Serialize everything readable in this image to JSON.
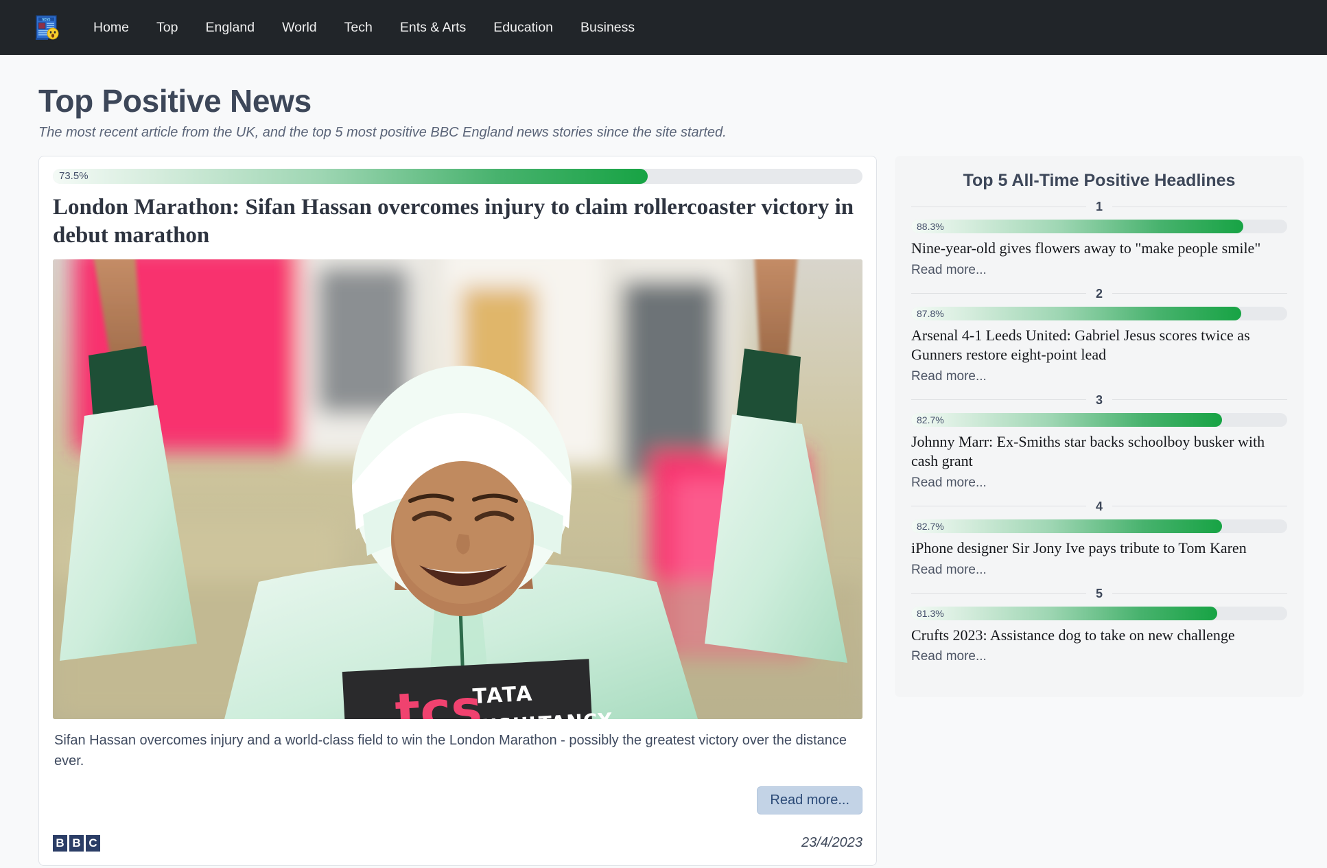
{
  "navbar": {
    "brand_icon": "newspaper-emoji-logo",
    "links": [
      {
        "label": "Home"
      },
      {
        "label": "Top"
      },
      {
        "label": "England"
      },
      {
        "label": "World"
      },
      {
        "label": "Tech"
      },
      {
        "label": "Ents & Arts"
      },
      {
        "label": "Education"
      },
      {
        "label": "Business"
      }
    ]
  },
  "page": {
    "title": "Top Positive News",
    "subtitle": "The most recent article from the UK, and the top 5 most positive BBC England news stories since the site started."
  },
  "featured": {
    "score_label": "73.5%",
    "score_value": 73.5,
    "headline": "London Marathon: Sifan Hassan overcomes injury to claim rollercoaster victory in debut marathon",
    "image_alt": "Sifan Hassan celebrating with arms raised wearing a pale green running top and white headscarf, TATA Consultancy race bib",
    "summary": "Sifan Hassan overcomes injury and a world-class field to win the London Marathon - possibly the greatest victory over the distance ever.",
    "read_more_label": "Read more...",
    "source": "BBC",
    "source_letters": [
      "B",
      "B",
      "C"
    ],
    "date": "23/4/2023"
  },
  "sidebar": {
    "title": "Top 5 All-Time Positive Headlines",
    "read_more_label": "Read more...",
    "items": [
      {
        "rank": "1",
        "score_label": "88.3%",
        "score_value": 88.3,
        "headline": "Nine-year-old gives flowers away to \"make people smile\"",
        "read_more_label": "Read more..."
      },
      {
        "rank": "2",
        "score_label": "87.8%",
        "score_value": 87.8,
        "headline": "Arsenal 4-1 Leeds United: Gabriel Jesus scores twice as Gunners restore eight-point lead",
        "read_more_label": "Read more..."
      },
      {
        "rank": "3",
        "score_label": "82.7%",
        "score_value": 82.7,
        "headline": "Johnny Marr: Ex-Smiths star backs schoolboy busker with cash grant",
        "read_more_label": "Read more..."
      },
      {
        "rank": "4",
        "score_label": "82.7%",
        "score_value": 82.7,
        "headline": "iPhone designer Sir Jony Ive pays tribute to Tom Karen",
        "read_more_label": "Read more..."
      },
      {
        "rank": "5",
        "score_label": "81.3%",
        "score_value": 81.3,
        "headline": "Crufts 2023: Assistance dog to take on new challenge",
        "read_more_label": "Read more..."
      }
    ]
  },
  "colors": {
    "navbar_bg": "#212529",
    "page_bg": "#f8f9fa",
    "heading": "#3d4759",
    "progress_green": "#17a344",
    "progress_track": "#e7e9ec",
    "button_bg": "#c3d3e6",
    "button_text": "#2b4a77",
    "bbc_navy": "#2b3d66"
  }
}
